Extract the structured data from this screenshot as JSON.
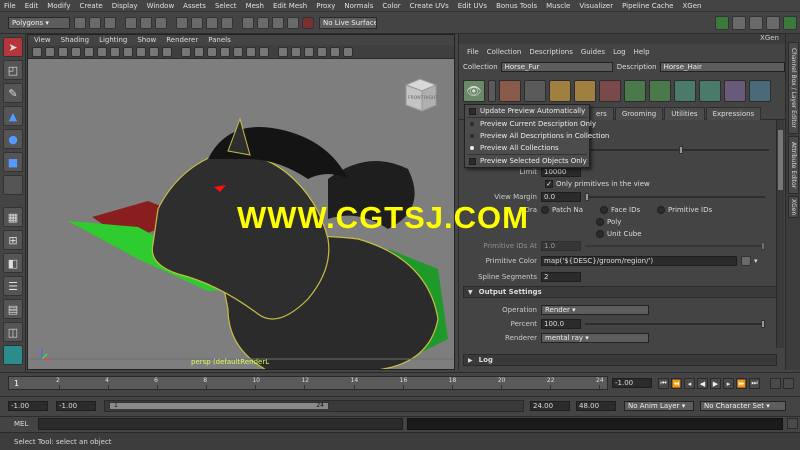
{
  "main_menu": [
    "File",
    "Edit",
    "Modify",
    "Create",
    "Display",
    "Window",
    "Assets",
    "Select",
    "Mesh",
    "Edit Mesh",
    "Proxy",
    "Normals",
    "Color",
    "Create UVs",
    "Edit UVs",
    "Bonus Tools",
    "Muscle",
    "Visualizer",
    "Pipeline Cache",
    "XGen"
  ],
  "status_line": {
    "menu_set": "Polygons",
    "live_surface": "No Live Surface"
  },
  "viewport": {
    "menus": [
      "View",
      "Shading",
      "Lighting",
      "Show",
      "Renderer",
      "Panels"
    ],
    "camera_label": "persp (defaultRenderL",
    "viewcube_front": "FRONT",
    "viewcube_right": "RIGHT",
    "watermark": "WWW.CGTSJ.COM"
  },
  "xgen": {
    "title": "XGen",
    "menus": [
      "File",
      "Collection",
      "Descriptions",
      "Guides",
      "Log",
      "Help"
    ],
    "collection_label": "Collection",
    "collection_value": "Horse_Fur",
    "description_label": "Description",
    "description_value": "Horse_Hair",
    "tabs": [
      "ers",
      "Grooming",
      "Utilities",
      "Expressions"
    ],
    "limit_label": "Limit",
    "limit_value": "10000",
    "only_primitives_label": "Only primitives in the view",
    "view_margin_label": "View Margin",
    "view_margin_value": "0.0",
    "color_by_label": "Dra",
    "color_options": [
      "Patch Na",
      "Face IDs",
      "Primitive IDs",
      "Poly",
      "Unit Cube"
    ],
    "primitive_ids_at_label": "Primitive IDs At",
    "primitive_ids_at_value": "1.0",
    "primitive_color_label": "Primitive Color",
    "primitive_color_value": "map('${DESC}/groom/region/')",
    "spline_segments_label": "Spline Segments",
    "spline_segments_value": "2",
    "output_section": "Output Settings",
    "operation_label": "Operation",
    "operation_value": "Render",
    "percent_label": "Percent",
    "percent_value": "100.0",
    "renderer_label": "Renderer",
    "renderer_value": "mental ray",
    "log_section": "Log"
  },
  "preview_menu": {
    "items": [
      {
        "label": "Update Preview Automatically",
        "kind": "check",
        "selected": false
      },
      {
        "label": "Preview Current Description Only",
        "kind": "radio",
        "selected": false
      },
      {
        "label": "Preview All Descriptions in Collection",
        "kind": "radio",
        "selected": false
      },
      {
        "label": "Preview All Collections",
        "kind": "radio",
        "selected": true
      },
      {
        "label": "Preview Selected Objects Only",
        "kind": "check",
        "selected": false
      }
    ]
  },
  "right_dock": [
    "Channel Box / Layer Editor",
    "Attribute Editor",
    "XGen"
  ],
  "timeslider": {
    "current_frame": "1",
    "ticks": [
      "2",
      "4",
      "6",
      "8",
      "10",
      "12",
      "14",
      "16",
      "18",
      "20",
      "22",
      "24"
    ],
    "end_field": "-1.00"
  },
  "range": {
    "start_min": "-1.00",
    "start": "-1.00",
    "range_start": "1",
    "range_end": "24",
    "end": "24.00",
    "end_max": "48.00",
    "anim_layer": "No Anim Layer",
    "character_set": "No Character Set"
  },
  "command_line": {
    "language": "MEL"
  },
  "help_line": "Select Tool: select an object",
  "colors": {
    "accent_green": "#3fcf3f",
    "wire_yellow": "#d8d050",
    "watermark": "#ffff00"
  }
}
